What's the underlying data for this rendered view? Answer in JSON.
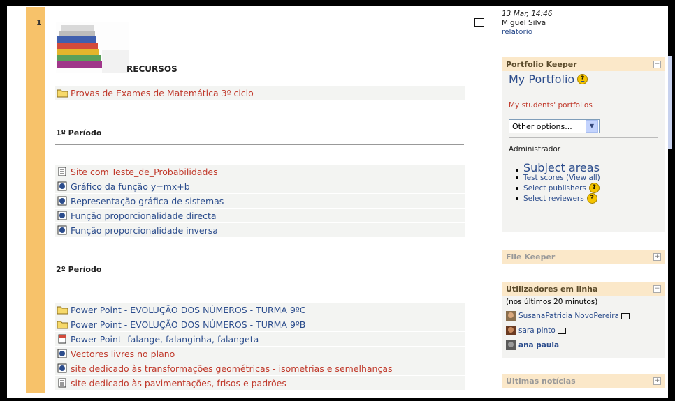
{
  "section": {
    "number": "1",
    "heading": "RECURSOS"
  },
  "resources_top": [
    {
      "label": "Provas de Exames de Matemática 3º ciclo",
      "icon": "folder-icon"
    }
  ],
  "period1": {
    "title": "1º Período",
    "items": [
      {
        "label": "Site com Teste_de_Probabilidades",
        "icon": "page-icon"
      },
      {
        "label": "Gráfico da função y=mx+b",
        "icon": "gsp-icon"
      },
      {
        "label": "Representação gráfica de sistemas",
        "icon": "gsp-icon"
      },
      {
        "label": "Função proporcionalidade directa",
        "icon": "gsp-icon"
      },
      {
        "label": "Função proporcionalidade inversa",
        "icon": "gsp-icon"
      }
    ]
  },
  "period2": {
    "title": "2º Período",
    "items": [
      {
        "label": "Power Point - EVOLUÇÃO DOS NÚMEROS - TURMA 9ºC",
        "icon": "folder-icon"
      },
      {
        "label": "Power Point - EVOLUÇÃO DOS NÚMEROS - TURMA 9ºB",
        "icon": "folder-icon"
      },
      {
        "label": "Power Point- falange, falanginha, falangeta",
        "icon": "ppt-icon"
      },
      {
        "label": "Vectores livres no plano",
        "icon": "gsp-icon"
      },
      {
        "label": "site dedicado às transformações geométricas - isometrias e semelhanças",
        "icon": "gsp-icon"
      },
      {
        "label": "site dedicado às pavimentações, frisos e padrões",
        "icon": "page-icon"
      }
    ]
  },
  "recent_activity": {
    "date": "13 Mar, 14:46",
    "user": "Miguel Silva",
    "link": "relatorio"
  },
  "portfolio_keeper": {
    "title": "Portfolio Keeper",
    "my_portfolio": "My Portfolio",
    "students_link": "My students' portfolios",
    "select_value": "Other options...",
    "admin_label": "Administrador",
    "subject_areas": "Subject areas",
    "test_scores": "Test scores (View all)",
    "select_publishers": "Select publishers",
    "select_reviewers": "Select reviewers"
  },
  "file_keeper": {
    "title": "File Keeper"
  },
  "online_users": {
    "title": "Utilizadores em linha",
    "subtitle": "(nos últimos 20 minutos)",
    "users": [
      {
        "name": "SusanaPatricia NovoPereira"
      },
      {
        "name": "sara pinto"
      },
      {
        "name": "ana paula"
      }
    ]
  },
  "latest_news": {
    "title": "Últimas notícias"
  },
  "colors": {
    "section_bar": "#f7c26a",
    "block_header": "#fbe8c9",
    "link_red": "#c0392b",
    "link_blue": "#2b4c8c"
  }
}
